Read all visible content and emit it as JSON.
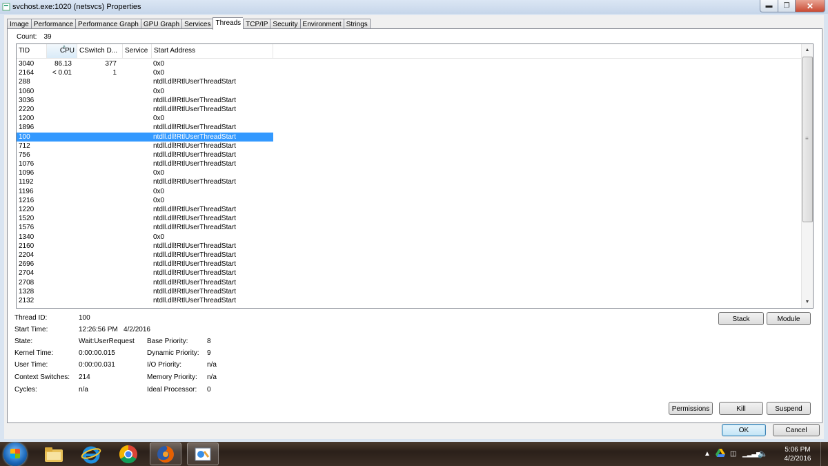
{
  "window": {
    "title": "svchost.exe:1020 (netsvcs) Properties"
  },
  "tabs": [
    {
      "label": "Image",
      "active": false
    },
    {
      "label": "Performance",
      "active": false
    },
    {
      "label": "Performance Graph",
      "active": false
    },
    {
      "label": "GPU Graph",
      "active": false
    },
    {
      "label": "Services",
      "active": false
    },
    {
      "label": "Threads",
      "active": true
    },
    {
      "label": "TCP/IP",
      "active": false
    },
    {
      "label": "Security",
      "active": false
    },
    {
      "label": "Environment",
      "active": false
    },
    {
      "label": "Strings",
      "active": false
    }
  ],
  "count": {
    "label": "Count:",
    "value": "39"
  },
  "columns": {
    "tid": "TID",
    "cpu": "CPU",
    "cswitch": "CSwitch D...",
    "service": "Service",
    "start": "Start Address"
  },
  "threads": [
    {
      "tid": "3040",
      "cpu": "86.13",
      "csw": "377",
      "start": "0x0"
    },
    {
      "tid": "2164",
      "cpu": "< 0.01",
      "csw": "1",
      "start": "0x0"
    },
    {
      "tid": "288",
      "cpu": "",
      "csw": "",
      "start": "ntdll.dll!RtlUserThreadStart"
    },
    {
      "tid": "1060",
      "cpu": "",
      "csw": "",
      "start": "0x0"
    },
    {
      "tid": "3036",
      "cpu": "",
      "csw": "",
      "start": "ntdll.dll!RtlUserThreadStart"
    },
    {
      "tid": "2220",
      "cpu": "",
      "csw": "",
      "start": "ntdll.dll!RtlUserThreadStart"
    },
    {
      "tid": "1200",
      "cpu": "",
      "csw": "",
      "start": "0x0"
    },
    {
      "tid": "1896",
      "cpu": "",
      "csw": "",
      "start": "ntdll.dll!RtlUserThreadStart"
    },
    {
      "tid": "100",
      "cpu": "",
      "csw": "",
      "start": "ntdll.dll!RtlUserThreadStart",
      "selected": true
    },
    {
      "tid": "712",
      "cpu": "",
      "csw": "",
      "start": "ntdll.dll!RtlUserThreadStart"
    },
    {
      "tid": "756",
      "cpu": "",
      "csw": "",
      "start": "ntdll.dll!RtlUserThreadStart"
    },
    {
      "tid": "1076",
      "cpu": "",
      "csw": "",
      "start": "ntdll.dll!RtlUserThreadStart"
    },
    {
      "tid": "1096",
      "cpu": "",
      "csw": "",
      "start": "0x0"
    },
    {
      "tid": "1192",
      "cpu": "",
      "csw": "",
      "start": "ntdll.dll!RtlUserThreadStart"
    },
    {
      "tid": "1196",
      "cpu": "",
      "csw": "",
      "start": "0x0"
    },
    {
      "tid": "1216",
      "cpu": "",
      "csw": "",
      "start": "0x0"
    },
    {
      "tid": "1220",
      "cpu": "",
      "csw": "",
      "start": "ntdll.dll!RtlUserThreadStart"
    },
    {
      "tid": "1520",
      "cpu": "",
      "csw": "",
      "start": "ntdll.dll!RtlUserThreadStart"
    },
    {
      "tid": "1576",
      "cpu": "",
      "csw": "",
      "start": "ntdll.dll!RtlUserThreadStart"
    },
    {
      "tid": "1340",
      "cpu": "",
      "csw": "",
      "start": "0x0"
    },
    {
      "tid": "2160",
      "cpu": "",
      "csw": "",
      "start": "ntdll.dll!RtlUserThreadStart"
    },
    {
      "tid": "2204",
      "cpu": "",
      "csw": "",
      "start": "ntdll.dll!RtlUserThreadStart"
    },
    {
      "tid": "2696",
      "cpu": "",
      "csw": "",
      "start": "ntdll.dll!RtlUserThreadStart"
    },
    {
      "tid": "2704",
      "cpu": "",
      "csw": "",
      "start": "ntdll.dll!RtlUserThreadStart"
    },
    {
      "tid": "2708",
      "cpu": "",
      "csw": "",
      "start": "ntdll.dll!RtlUserThreadStart"
    },
    {
      "tid": "1328",
      "cpu": "",
      "csw": "",
      "start": "ntdll.dll!RtlUserThreadStart"
    },
    {
      "tid": "2132",
      "cpu": "",
      "csw": "",
      "start": "ntdll.dll!RtlUserThreadStart"
    }
  ],
  "details": {
    "thread_id": {
      "label": "Thread ID:",
      "value": "100"
    },
    "start_time": {
      "label": "Start Time:",
      "value": "12:26:56 PM   4/2/2016"
    },
    "state": {
      "label": "State:",
      "value": "Wait:UserRequest"
    },
    "kernel_time": {
      "label": "Kernel Time:",
      "value": "0:00:00.015"
    },
    "user_time": {
      "label": "User Time:",
      "value": "0:00:00.031"
    },
    "context_switches": {
      "label": "Context Switches:",
      "value": "214"
    },
    "cycles": {
      "label": "Cycles:",
      "value": "n/a"
    },
    "base_priority": {
      "label": "Base Priority:",
      "value": "8"
    },
    "dynamic_priority": {
      "label": "Dynamic Priority:",
      "value": "9"
    },
    "io_priority": {
      "label": "I/O Priority:",
      "value": "n/a"
    },
    "memory_priority": {
      "label": "Memory Priority:",
      "value": "n/a"
    },
    "ideal_processor": {
      "label": "Ideal Processor:",
      "value": "0"
    }
  },
  "buttons": {
    "stack": "Stack",
    "module": "Module",
    "permissions": "Permissions",
    "kill": "Kill",
    "suspend": "Suspend",
    "ok": "OK",
    "cancel": "Cancel"
  },
  "taskbar": {
    "items": [
      "file-explorer-icon",
      "internet-explorer-icon",
      "chrome-icon",
      "firefox-icon",
      "process-explorer-icon"
    ],
    "clock": {
      "time": "5:06 PM",
      "date": "4/2/2016"
    }
  }
}
